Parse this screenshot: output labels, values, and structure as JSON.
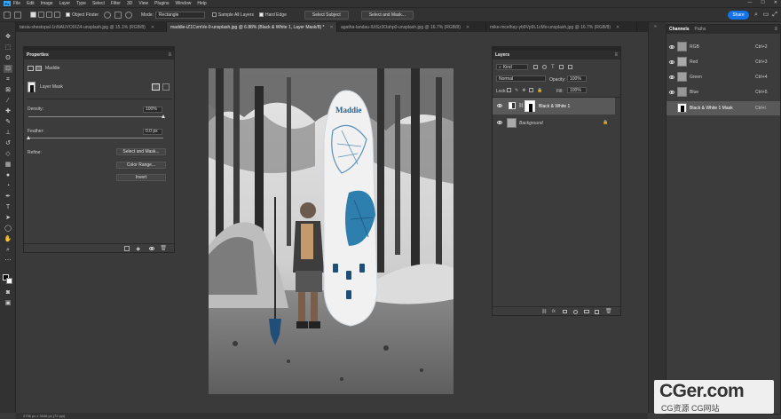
{
  "app": {
    "logo": "Ps"
  },
  "menu": [
    "File",
    "Edit",
    "Image",
    "Layer",
    "Type",
    "Select",
    "Filter",
    "3D",
    "View",
    "Plugins",
    "Window",
    "Help"
  ],
  "options_bar": {
    "object_finder": "Object Finder",
    "mode_label": "Mode:",
    "mode_value": "Rectangle",
    "sample_all_layers": "Sample All Layers",
    "hard_edge": "Hard Edge",
    "select_subject": "Select Subject",
    "select_and_mask": "Select and Mask...",
    "share": "Share"
  },
  "tabs": [
    {
      "label": "taisia-shestopal-1nNAUVOIXZ4-unsplash.jpg @ 15.1% (RGB/8)",
      "active": false
    },
    {
      "label": "maddie-iZ1CvmVe-0-unsplash.jpg @ 6.88% (Black & White 1, Layer Mask/8) *",
      "active": true
    },
    {
      "label": "agatha-landau-lUtSz3Oahp0-unsplash.jpg @ 16.7% (RGB/8)",
      "active": false
    },
    {
      "label": "mike-mcelhay-yb9Vp9L1cMo-unsplash.jpg @ 16.7% (RGB/8)",
      "active": false
    }
  ],
  "properties": {
    "title": "Properties",
    "layer_name": "Maddie",
    "section": "Layer Mask",
    "density_label": "Density:",
    "density_value": "100%",
    "density_level": 1.0,
    "feather_label": "Feather:",
    "feather_value": "0.0 px",
    "feather_level": 0.0,
    "refine_label": "Refine:",
    "select_and_mask": "Select and Mask...",
    "color_range": "Color Range...",
    "invert": "Invert"
  },
  "layers": {
    "title": "Layers",
    "filter": "Kind",
    "blend_mode": "Normal",
    "opacity_label": "Opacity:",
    "opacity_value": "100%",
    "lock_label": "Lock:",
    "fill_label": "Fill:",
    "fill_value": "100%",
    "items": [
      {
        "name": "Black & White 1",
        "selected": true
      },
      {
        "name": "Background",
        "selected": false
      }
    ]
  },
  "channels": {
    "tabs": [
      "Channels",
      "Paths"
    ],
    "items": [
      {
        "name": "RGB",
        "shortcut": "Ctrl+2"
      },
      {
        "name": "Red",
        "shortcut": "Ctrl+3"
      },
      {
        "name": "Green",
        "shortcut": "Ctrl+4"
      },
      {
        "name": "Blue",
        "shortcut": "Ctrl+5"
      },
      {
        "name": "Black & White 1 Mask",
        "shortcut": "Ctrl+\\"
      }
    ]
  },
  "photo": {
    "board_text": "Maddie"
  },
  "watermark": {
    "main": "CGer.com",
    "sub": "CG资源 CG网站"
  },
  "status": "2796 px x 3948 px (72 ppi)"
}
